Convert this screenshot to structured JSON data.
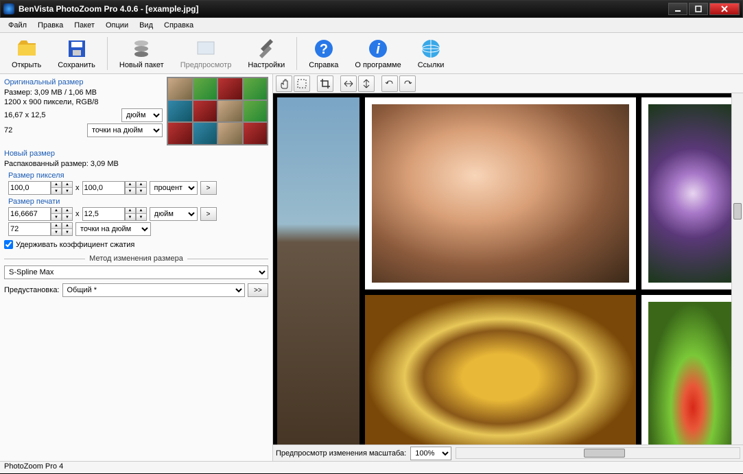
{
  "window": {
    "title": "BenVista PhotoZoom Pro 4.0.6 - [example.jpg]"
  },
  "menu": {
    "file": "Файл",
    "edit": "Правка",
    "batch": "Пакет",
    "options": "Опции",
    "view": "Вид",
    "help": "Справка"
  },
  "toolbar": {
    "open": "Открыть",
    "save": "Сохранить",
    "new_batch": "Новый пакет",
    "preview": "Предпросмотр",
    "settings": "Настройки",
    "help": "Справка",
    "about": "О программе",
    "links": "Ссылки"
  },
  "original": {
    "header": "Оригинальный размер",
    "size_label": "Размер: 3,09 MB / 1,06 MB",
    "dims": "1200 x 900 пиксели, RGB/8",
    "phys": "16,67 x 12,5",
    "phys_unit": "дюйм",
    "dpi": "72",
    "dpi_unit": "точки на дюйм"
  },
  "newsize": {
    "header": "Новый размер",
    "unpacked": "Распакованный размер: 3,09 MB",
    "pixel_hdr": "Размер пикселя",
    "px_w": "100,0",
    "px_h": "100,0",
    "px_unit": "процент",
    "print_hdr": "Размер печати",
    "pr_w": "16,6667",
    "pr_h": "12,5",
    "pr_unit": "дюйм",
    "res": "72",
    "res_unit": "точки на дюйм",
    "keep_ratio": "Удерживать коэффициент сжатия"
  },
  "resize": {
    "header": "Метод изменения размера",
    "method": "S-Spline Max",
    "preset_label": "Предустановка:",
    "preset": "Общий *",
    "go": ">>"
  },
  "previewbar": {
    "label": "Предпросмотр изменения масштаба:",
    "zoom": "100%"
  },
  "status": {
    "text": "PhotoZoom Pro 4"
  },
  "x_sep": "x",
  "go_arrow": ">"
}
